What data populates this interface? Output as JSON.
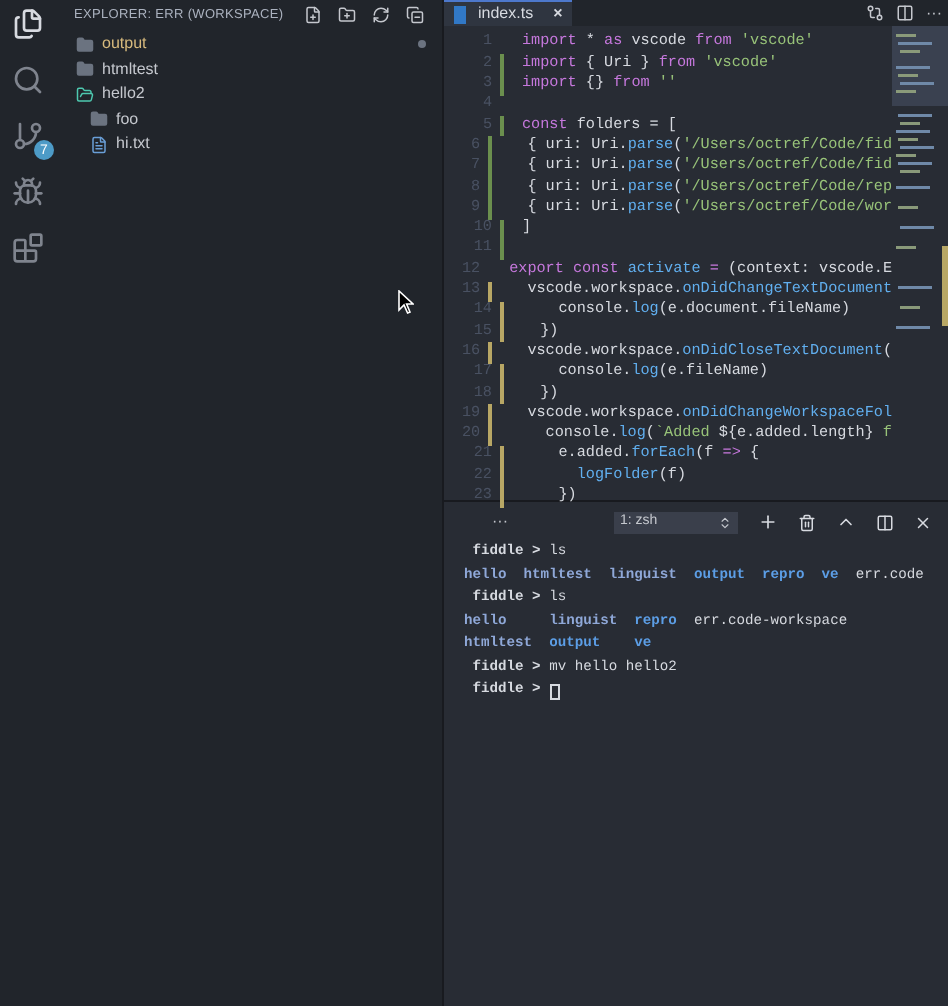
{
  "activity_bar": {
    "items": [
      {
        "kind": "files",
        "selected": true
      },
      {
        "kind": "search",
        "selected": false
      },
      {
        "kind": "scm",
        "selected": false,
        "badge": "7"
      },
      {
        "kind": "debug",
        "selected": false
      },
      {
        "kind": "extensions",
        "selected": false
      }
    ]
  },
  "sidebar": {
    "title": "EXPLORER: ERR (WORKSPACE)",
    "items": [
      {
        "label": "output",
        "kind": "folder",
        "modified": true,
        "expanded": false
      },
      {
        "label": "htmltest",
        "kind": "folder",
        "modified": false,
        "expanded": false
      },
      {
        "label": "hello2",
        "kind": "folder",
        "modified": false,
        "expanded": true,
        "children": [
          {
            "label": "foo",
            "kind": "folder",
            "modified": false,
            "expanded": false
          },
          {
            "label": "hi.txt",
            "kind": "file",
            "modified": false,
            "expanded": false
          }
        ]
      }
    ]
  },
  "editor": {
    "tabs": [
      {
        "label": "index.ts",
        "selected": true,
        "close": "×"
      }
    ],
    "more": "···",
    "lines": [
      {
        "number": "1",
        "kind": "unchanged",
        "tokens": [
          {
            "text": "import ",
            "kind": "keyword"
          },
          {
            "text": "* ",
            "kind": "plain"
          },
          {
            "text": "as ",
            "kind": "keyword"
          },
          {
            "text": "vscode ",
            "kind": "plain"
          },
          {
            "text": "from ",
            "kind": "keyword"
          },
          {
            "text": "'vscode'",
            "kind": "string"
          }
        ]
      },
      {
        "number": "2",
        "kind": "added",
        "tokens": [
          {
            "text": "import ",
            "kind": "keyword"
          },
          {
            "text": "{ Uri } ",
            "kind": "plain"
          },
          {
            "text": "from ",
            "kind": "keyword"
          },
          {
            "text": "'vscode'",
            "kind": "string"
          }
        ]
      },
      {
        "number": "3",
        "kind": "added",
        "tokens": [
          {
            "text": "import ",
            "kind": "keyword"
          },
          {
            "text": "{} ",
            "kind": "plain"
          },
          {
            "text": "from ",
            "kind": "keyword"
          },
          {
            "text": "''",
            "kind": "string"
          }
        ]
      },
      {
        "number": "4",
        "kind": "unchanged"
      },
      {
        "number": "5",
        "kind": "added",
        "tokens": [
          {
            "text": "const ",
            "kind": "keyword"
          },
          {
            "text": "folders = [",
            "kind": "plain"
          }
        ]
      },
      {
        "number": "6",
        "kind": "added",
        "tokens": [
          {
            "text": "  { uri: Uri.",
            "kind": "plain"
          },
          {
            "text": "parse",
            "kind": "function"
          },
          {
            "text": "(",
            "kind": "plain"
          },
          {
            "text": "'/Users/octref/Code/fid",
            "kind": "string"
          }
        ]
      },
      {
        "number": "7",
        "kind": "added",
        "tokens": [
          {
            "text": "  { uri: Uri.",
            "kind": "plain"
          },
          {
            "text": "parse",
            "kind": "function"
          },
          {
            "text": "(",
            "kind": "plain"
          },
          {
            "text": "'/Users/octref/Code/fid",
            "kind": "string"
          }
        ]
      },
      {
        "number": "8",
        "kind": "added",
        "tokens": [
          {
            "text": "  { uri: Uri.",
            "kind": "plain"
          },
          {
            "text": "parse",
            "kind": "function"
          },
          {
            "text": "(",
            "kind": "plain"
          },
          {
            "text": "'/Users/octref/Code/rep",
            "kind": "string"
          }
        ]
      },
      {
        "number": "9",
        "kind": "added",
        "tokens": [
          {
            "text": "  { uri: Uri.",
            "kind": "plain"
          },
          {
            "text": "parse",
            "kind": "function"
          },
          {
            "text": "(",
            "kind": "plain"
          },
          {
            "text": "'/Users/octref/Code/wor",
            "kind": "string"
          }
        ]
      },
      {
        "number": "10",
        "kind": "added",
        "tokens": [
          {
            "text": "]",
            "kind": "plain"
          }
        ]
      },
      {
        "number": "11",
        "kind": "added"
      },
      {
        "number": "12",
        "kind": "unchanged",
        "tokens": [
          {
            "text": "export ",
            "kind": "keyword"
          },
          {
            "text": "const ",
            "kind": "keyword"
          },
          {
            "text": "activate ",
            "kind": "function"
          },
          {
            "text": "= ",
            "kind": "keyword"
          },
          {
            "text": "(context: vscode.E",
            "kind": "plain"
          }
        ]
      },
      {
        "number": "13",
        "kind": "modified",
        "tokens": [
          {
            "text": "  vscode.workspace.",
            "kind": "plain"
          },
          {
            "text": "onDidChangeTextDocument",
            "kind": "function"
          }
        ]
      },
      {
        "number": "14",
        "kind": "modified",
        "tokens": [
          {
            "text": "    console.",
            "kind": "plain"
          },
          {
            "text": "log",
            "kind": "function"
          },
          {
            "text": "(e.document.fileName)",
            "kind": "plain"
          }
        ]
      },
      {
        "number": "15",
        "kind": "modified",
        "tokens": [
          {
            "text": "  })",
            "kind": "plain"
          }
        ]
      },
      {
        "number": "16",
        "kind": "modified",
        "tokens": [
          {
            "text": "  vscode.workspace.",
            "kind": "plain"
          },
          {
            "text": "onDidCloseTextDocument",
            "kind": "function"
          },
          {
            "text": "(",
            "kind": "plain"
          }
        ]
      },
      {
        "number": "17",
        "kind": "modified",
        "tokens": [
          {
            "text": "    console.",
            "kind": "plain"
          },
          {
            "text": "log",
            "kind": "function"
          },
          {
            "text": "(e.fileName)",
            "kind": "plain"
          }
        ]
      },
      {
        "number": "18",
        "kind": "modified",
        "tokens": [
          {
            "text": "  })",
            "kind": "plain"
          }
        ]
      },
      {
        "number": "19",
        "kind": "modified",
        "tokens": [
          {
            "text": "  vscode.workspace.",
            "kind": "plain"
          },
          {
            "text": "onDidChangeWorkspaceFol",
            "kind": "function"
          }
        ]
      },
      {
        "number": "20",
        "kind": "modified",
        "tokens": [
          {
            "text": "    console.",
            "kind": "plain"
          },
          {
            "text": "log",
            "kind": "function"
          },
          {
            "text": "(",
            "kind": "plain"
          },
          {
            "text": "`Added ",
            "kind": "string"
          },
          {
            "text": "${e.added.length}",
            "kind": "plain"
          },
          {
            "text": " f",
            "kind": "string"
          }
        ]
      },
      {
        "number": "21",
        "kind": "modified",
        "tokens": [
          {
            "text": "    e.added.",
            "kind": "plain"
          },
          {
            "text": "forEach",
            "kind": "function"
          },
          {
            "text": "(f ",
            "kind": "plain"
          },
          {
            "text": "=> ",
            "kind": "keyword"
          },
          {
            "text": "{",
            "kind": "plain"
          }
        ]
      },
      {
        "number": "22",
        "kind": "modified",
        "tokens": [
          {
            "text": "      logFolder",
            "kind": "function"
          },
          {
            "text": "(f)",
            "kind": "plain"
          }
        ]
      },
      {
        "number": "23",
        "kind": "modified",
        "tokens": [
          {
            "text": "    })",
            "kind": "plain"
          }
        ]
      }
    ]
  },
  "terminal": {
    "more": "···",
    "select": "1: zsh",
    "lines": [
      {
        "tokens": [
          {
            "text": " fiddle > ",
            "kind": "prompt"
          },
          {
            "text": "ls",
            "kind": "plain"
          }
        ]
      },
      {
        "tokens": [
          {
            "text": "hello  htmltest  linguist  ",
            "kind": "dir"
          },
          {
            "text": "output  repro  ve  ",
            "kind": "link"
          },
          {
            "text": "err.code",
            "kind": "plain"
          }
        ]
      },
      {
        "tokens": [
          {
            "text": " fiddle > ",
            "kind": "prompt"
          },
          {
            "text": "ls",
            "kind": "plain"
          }
        ]
      },
      {
        "tokens": [
          {
            "text": "hello     linguist  ",
            "kind": "dir"
          },
          {
            "text": "repro  ",
            "kind": "link"
          },
          {
            "text": "err.code-workspace",
            "kind": "plain"
          }
        ]
      },
      {
        "tokens": [
          {
            "text": "htmltest  ",
            "kind": "dir"
          },
          {
            "text": "output    ve",
            "kind": "link"
          }
        ]
      },
      {
        "tokens": [
          {
            "text": " fiddle > ",
            "kind": "prompt"
          },
          {
            "text": "mv hello hello2",
            "kind": "plain"
          }
        ]
      },
      {
        "tokens": [
          {
            "text": " fiddle > ",
            "kind": "prompt"
          }
        ],
        "cursor": true
      }
    ]
  }
}
